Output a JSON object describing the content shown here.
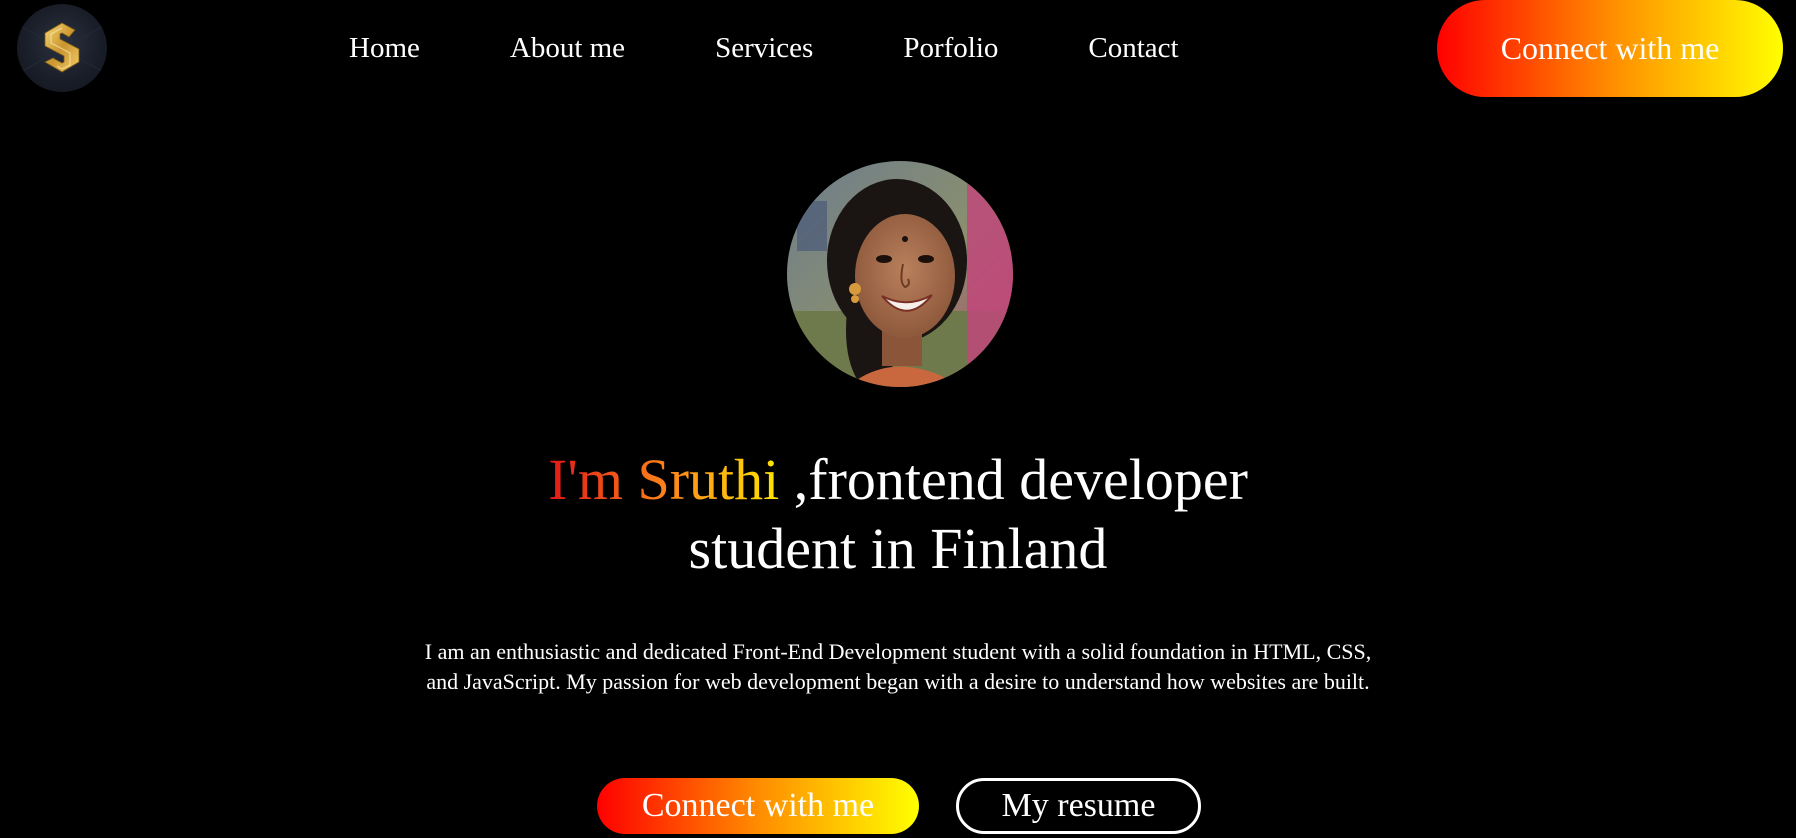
{
  "nav": {
    "logo_icon": "s-monogram-logo-icon",
    "items": [
      {
        "label": "Home"
      },
      {
        "label": "About me"
      },
      {
        "label": "Services"
      },
      {
        "label": "Porfolio"
      },
      {
        "label": "Contact"
      }
    ],
    "connect_label": "Connect with me"
  },
  "hero": {
    "avatar_icon": "profile-photo",
    "headline_name": "I'm Sruthi",
    "headline_rest_1": " ,frontend developer",
    "headline_rest_2": "student in Finland",
    "intro": "I am an enthusiastic and dedicated Front-End Development student with a solid foundation in HTML, CSS, and JavaScript. My passion for web development began with a desire to understand how websites are built.",
    "primary_button": "Connect with me",
    "secondary_button": "My resume"
  },
  "colors": {
    "background": "#000000",
    "text": "#ffffff",
    "gradient_start": "#ff0000",
    "gradient_mid": "#ff8c00",
    "gradient_end": "#ffff00"
  }
}
